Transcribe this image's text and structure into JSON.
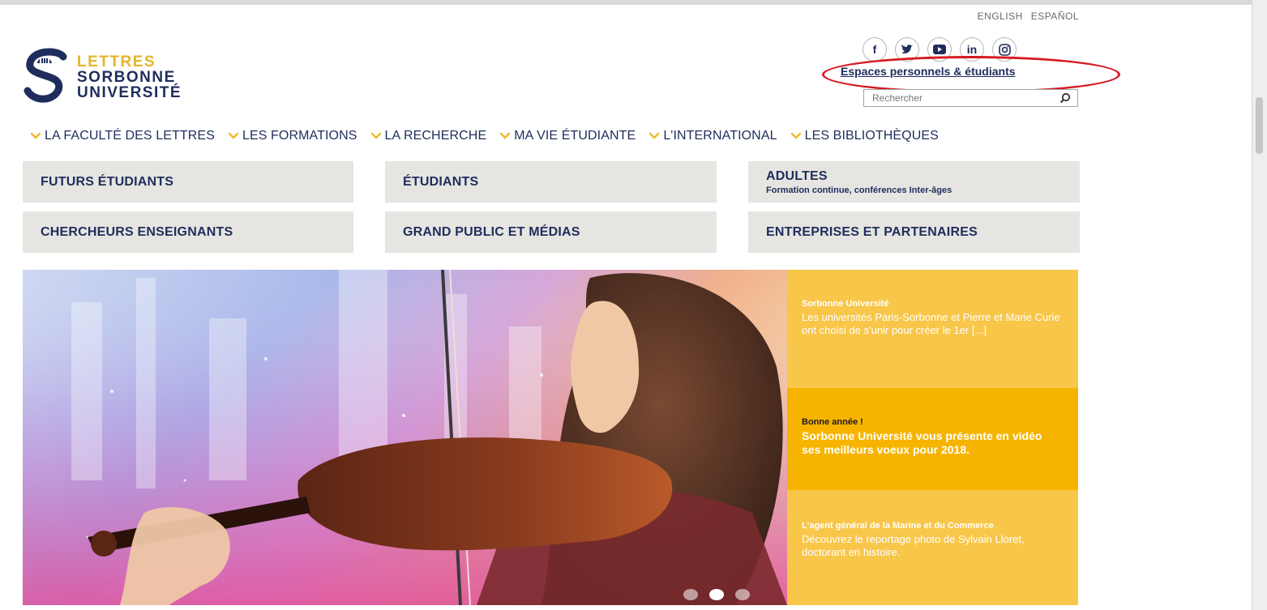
{
  "languages": [
    "ENGLISH",
    "ESPAÑOL"
  ],
  "logo": {
    "line1": "LETTRES",
    "line2": "SORBONNE",
    "line3": "UNIVERSITÉ"
  },
  "social": {
    "facebook": "f",
    "linkedin": "in"
  },
  "espaces_link": "Espaces personnels & étudiants",
  "search": {
    "placeholder": "Rechercher"
  },
  "nav": [
    "LA FACULTÉ DES LETTRES",
    "LES FORMATIONS",
    "LA RECHERCHE",
    "MA VIE ÉTUDIANTE",
    "L'INTERNATIONAL",
    "LES BIBLIOTHÈQUES"
  ],
  "audiences": [
    {
      "label": "FUTURS ÉTUDIANTS"
    },
    {
      "label": "ÉTUDIANTS"
    },
    {
      "label": "ADULTES",
      "sub": "Formation continue, conférences Inter-âges"
    },
    {
      "label": "CHERCHEURS ENSEIGNANTS"
    },
    {
      "label": "GRAND PUBLIC ET MÉDIAS"
    },
    {
      "label": "ENTREPRISES ET PARTENAIRES"
    }
  ],
  "news": [
    {
      "kicker": "Sorbonne Université",
      "body": "Les universités Paris-Sorbonne et Pierre et Marie Curie ont choisi de s'unir pour créer le 1er [...]"
    },
    {
      "kicker": "Bonne année !",
      "body": "Sorbonne Université vous présente en vidéo ses meilleurs voeux pour 2018."
    },
    {
      "kicker": "L'agent général de la Marine et du Commerce",
      "body": "Découvrez le reportage photo de Sylvain Lloret, doctorant en histoire."
    }
  ],
  "carousel": {
    "slide_count": 3,
    "active_index": 1
  },
  "colors": {
    "brand_navy": "#1f2d5c",
    "brand_gold": "#e3b52a",
    "highlight_oval": "#d71920",
    "panel_gold": "#f8c649",
    "panel_gold_dark": "#f6b400"
  }
}
